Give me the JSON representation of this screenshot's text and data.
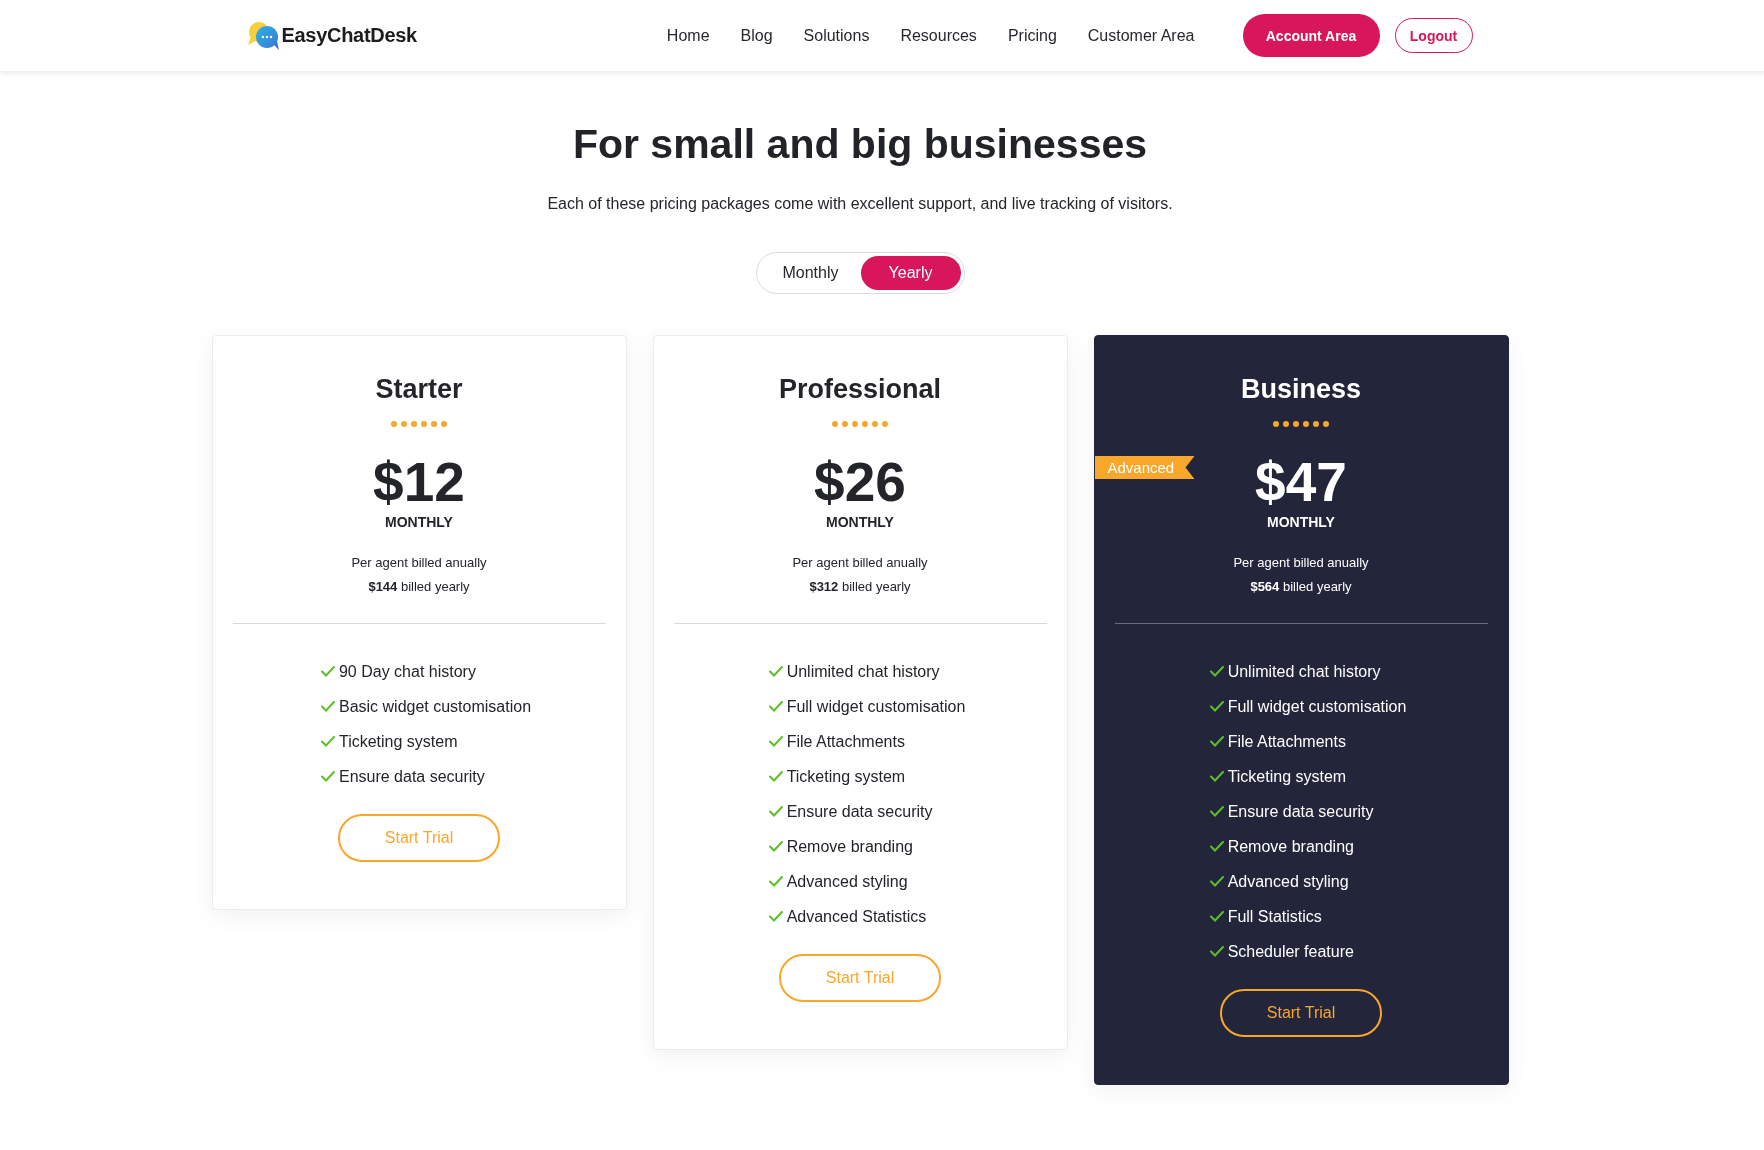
{
  "header": {
    "logo": "EasyChatDesk",
    "nav": [
      "Home",
      "Blog",
      "Solutions",
      "Resources",
      "Pricing",
      "Customer Area"
    ],
    "account_button": "Account Area",
    "logout_button": "Logout"
  },
  "hero": {
    "title": "For small and big businesses",
    "subtitle": "Each of these pricing packages come with excellent support, and live tracking of visitors."
  },
  "billing_toggle": [
    {
      "label": "Monthly",
      "selected": false
    },
    {
      "label": "Yearly",
      "selected": true
    }
  ],
  "plans": [
    {
      "name": "Starter",
      "featured": false,
      "price": "$12",
      "period": "MONTHLY",
      "billing_note": "Per agent billed anually",
      "yearly_total": "**$144** billed yearly",
      "features": [
        "90 Day chat history",
        "Basic widget customisation",
        "Ticketing system",
        "Ensure data security"
      ],
      "button": "Start Trial"
    },
    {
      "name": "Professional",
      "featured": false,
      "price": "$26",
      "period": "MONTHLY",
      "billing_note": "Per agent billed anually",
      "yearly_total": "**$312** billed yearly",
      "features": [
        "Unlimited chat history",
        "Full widget customisation",
        "File Attachments",
        "Ticketing system",
        "Ensure data security",
        "Remove branding",
        "Advanced styling",
        "Advanced Statistics"
      ],
      "button": "Start Trial"
    },
    {
      "name": "Business",
      "featured": true,
      "ribbon": "Advanced",
      "price": "$47",
      "period": "MONTHLY",
      "billing_note": "Per agent billed anually",
      "yearly_total": "**$564** billed yearly",
      "features": [
        "Unlimited chat history",
        "Full widget customisation",
        "File Attachments",
        "Ticketing system",
        "Ensure data security",
        "Remove branding",
        "Advanced styling",
        "Full Statistics",
        "Scheduler feature"
      ],
      "button": "Start Trial"
    }
  ]
}
